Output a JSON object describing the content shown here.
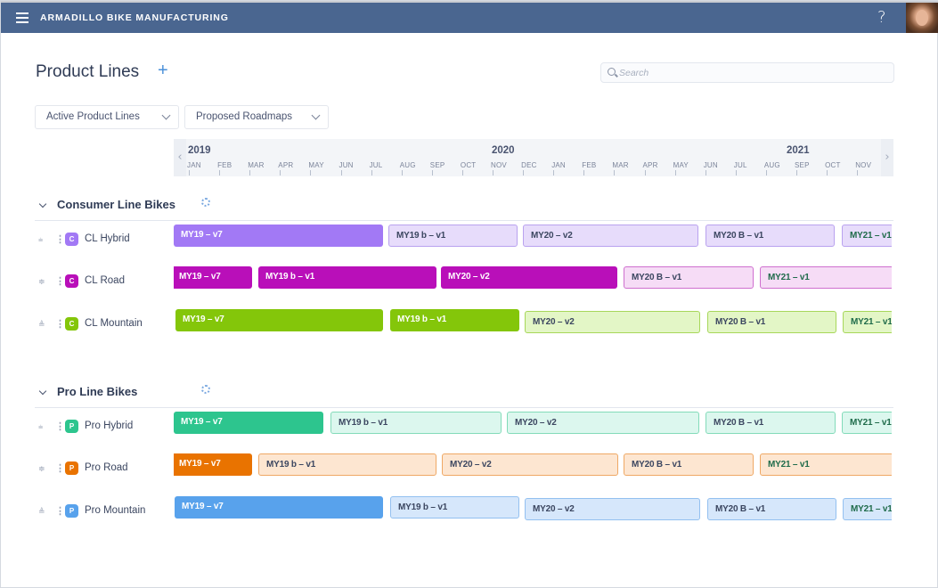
{
  "app": {
    "title": "ARMADILLO BIKE MANUFACTURING",
    "help_label": "?",
    "menu_icon": "hamburger-icon",
    "avatar_icon": "user-avatar"
  },
  "page": {
    "title": "Product Lines",
    "add_label": "+",
    "search": {
      "placeholder": "Search",
      "value": ""
    },
    "filters": [
      {
        "label": "Active Product Lines"
      },
      {
        "label": "Proposed Roadmaps"
      }
    ]
  },
  "timeline": {
    "years": [
      "2019",
      "2020",
      "2021"
    ],
    "months": [
      "JAN",
      "FEB",
      "MAR",
      "APR",
      "MAY",
      "JUN",
      "JUL",
      "AUG",
      "SEP",
      "OCT",
      "NOV",
      "DEC",
      "JAN",
      "FEB",
      "MAR",
      "APR",
      "MAY",
      "JUN",
      "JUL",
      "AUG",
      "SEP",
      "OCT",
      "NOV"
    ],
    "prev_label": "‹",
    "next_label": "›"
  },
  "sections": [
    {
      "title": "Consumer Line Bikes",
      "rows": [
        {
          "name": "CL Hybrid",
          "badge": "C",
          "priority": "low",
          "priority_glyph": "⩧",
          "color": "#a279f5",
          "light": "#e7dcfb",
          "border": "#b9a2ef",
          "bars": [
            {
              "label": "MY19 – v7",
              "style": "solid"
            },
            {
              "label": "MY19 b – v1",
              "style": "light"
            },
            {
              "label": "MY20 – v2",
              "style": "light"
            },
            {
              "label": "MY20 B – v1",
              "style": "light"
            },
            {
              "label": "MY21 – v1",
              "style": "light"
            }
          ]
        },
        {
          "name": "CL Road",
          "badge": "C",
          "priority": "medium",
          "priority_glyph": "≑",
          "color": "#b90fb9",
          "light": "#f6dcf6",
          "border": "#cf6fcf",
          "bars": [
            {
              "label": "MY19 – v7",
              "style": "solid"
            },
            {
              "label": "MY19 b – v1",
              "style": "solid"
            },
            {
              "label": "MY20 – v2",
              "style": "solid"
            },
            {
              "label": "MY20 B – v1",
              "style": "light"
            },
            {
              "label": "MY21 – v1",
              "style": "light"
            }
          ]
        },
        {
          "name": "CL Mountain",
          "badge": "C",
          "priority": "high",
          "priority_glyph": "≜",
          "color": "#84c60a",
          "light": "#e3f6c6",
          "border": "#a7d75a",
          "bars": [
            {
              "label": "MY19 – v7",
              "style": "solid"
            },
            {
              "label": "MY19 b – v1",
              "style": "solid"
            },
            {
              "label": "MY20 – v2",
              "style": "light"
            },
            {
              "label": "MY20 B – v1",
              "style": "light"
            },
            {
              "label": "MY21 – v1",
              "style": "light"
            }
          ]
        }
      ]
    },
    {
      "title": "Pro Line Bikes",
      "rows": [
        {
          "name": "Pro Hybrid",
          "badge": "P",
          "priority": "low",
          "priority_glyph": "⩧",
          "color": "#2dc58e",
          "light": "#dcf7ee",
          "border": "#83dbb9",
          "bars": [
            {
              "label": "MY19 – v7",
              "style": "solid"
            },
            {
              "label": "MY19 b – v1",
              "style": "light"
            },
            {
              "label": "MY20 – v2",
              "style": "light"
            },
            {
              "label": "MY20 B – v1",
              "style": "light"
            },
            {
              "label": "MY21 – v1",
              "style": "light"
            }
          ]
        },
        {
          "name": "Pro Road",
          "badge": "P",
          "priority": "medium",
          "priority_glyph": "≑",
          "color": "#e97300",
          "light": "#fde6d1",
          "border": "#efa865",
          "bars": [
            {
              "label": "MY19 – v7",
              "style": "solid"
            },
            {
              "label": "MY19 b – v1",
              "style": "light"
            },
            {
              "label": "MY20 – v2",
              "style": "light"
            },
            {
              "label": "MY20 B – v1",
              "style": "light"
            },
            {
              "label": "MY21 – v1",
              "style": "light"
            }
          ]
        },
        {
          "name": "Pro Mountain",
          "badge": "P",
          "priority": "high",
          "priority_glyph": "≜",
          "color": "#58a2ec",
          "light": "#d6e7fb",
          "border": "#93c0f0",
          "bars": [
            {
              "label": "MY19 – v7",
              "style": "solid"
            },
            {
              "label": "MY19 b – v1",
              "style": "light"
            },
            {
              "label": "MY20 – v2",
              "style": "light"
            },
            {
              "label": "MY20 B – v1",
              "style": "light"
            },
            {
              "label": "MY21 – v1",
              "style": "light"
            }
          ]
        }
      ]
    }
  ]
}
